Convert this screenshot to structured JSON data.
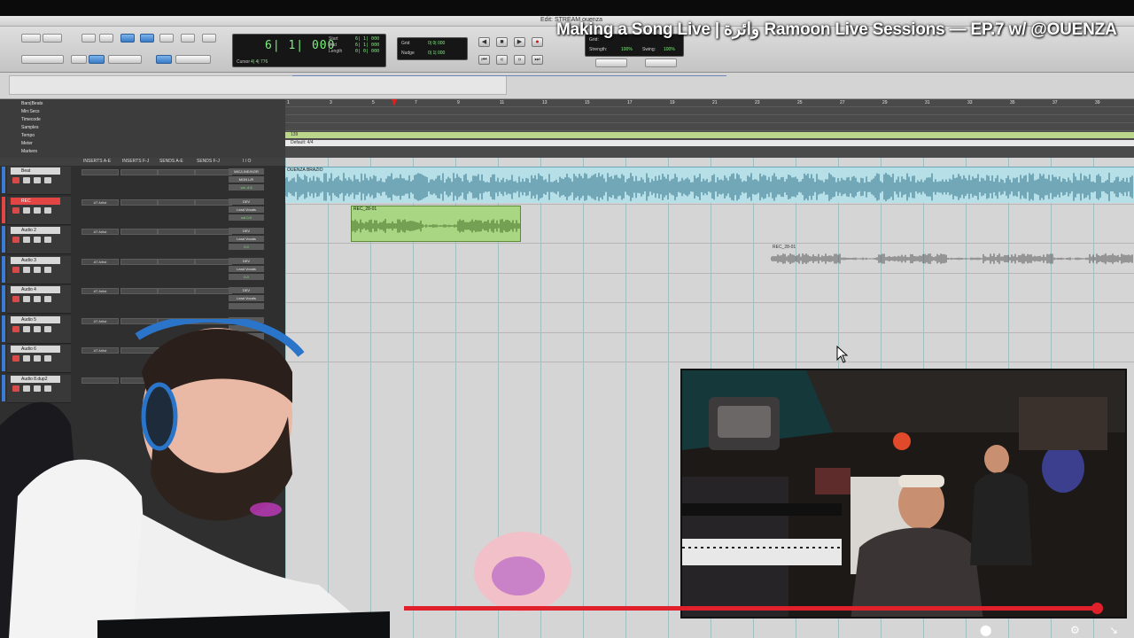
{
  "video": {
    "title": "Making a Song Live | وائرة Ramoon Live Sessions — EP.7 w/ @OUENZA",
    "progress": 0.94
  },
  "window": {
    "title": "Edit: STREAM ouenza"
  },
  "counter": {
    "main": "6| 1| 000",
    "start_label": "Start",
    "end_label": "End",
    "length_label": "Length",
    "start": "6| 1| 000",
    "end": "6| 1| 000",
    "length": "0| 0| 000",
    "cursor_label": "Cursor",
    "cursor": "4| 4| 776"
  },
  "nudge": {
    "grid_label": "Grid",
    "nudge_label": "Nudge",
    "grid_value": "0| 0| 000",
    "nudge_value": "0| 1| 000"
  },
  "quantize": {
    "grid_label": "Grid:",
    "strength_label": "Strength:",
    "strength": "100%",
    "swing_label": "Swing:",
    "swing": "100%"
  },
  "rulers": {
    "labels": [
      "Bars|Beats",
      "Min:Secs",
      "Timecode",
      "Samples",
      "Tempo",
      "Meter",
      "Markers"
    ],
    "bars": [
      "1",
      "3",
      "5",
      "7",
      "9",
      "11",
      "13",
      "15",
      "17",
      "19",
      "21",
      "23",
      "25",
      "27",
      "29",
      "31",
      "33",
      "35",
      "37",
      "39"
    ],
    "tempo": "139",
    "meter": "Default: 4/4"
  },
  "mix": {
    "columns": [
      "INSERTS A-E",
      "INSERTS F-J",
      "SENDS A-E",
      "SENDS F-J",
      "I / O"
    ],
    "tracks": [
      {
        "name": "Beat",
        "color": "#3a7bd5",
        "insert": "",
        "io1": "MIC/LINE/HZ/R",
        "io2": "MON L/R",
        "vol": "vol -4.6"
      },
      {
        "name": "REC",
        "color": "#e34444",
        "insert": "AT Artist",
        "io1": "DEV",
        "io2": "Lead Vocals",
        "vol": "vol 0.0",
        "rec": true
      },
      {
        "name": "Audio 2",
        "color": "#3a7bd5",
        "insert": "AT Artist",
        "io1": "DEV",
        "io2": "Lead Vocals",
        "vol": "0.0"
      },
      {
        "name": "Audio 3",
        "color": "#3a7bd5",
        "insert": "AT Artist",
        "io1": "DEV",
        "io2": "Lead Vocals",
        "vol": "0.0"
      },
      {
        "name": "Audio 4",
        "color": "#3a7bd5",
        "insert": "AT Artist",
        "io1": "DEV",
        "io2": "Lead Vocals",
        "vol": ""
      },
      {
        "name": "Audio 5",
        "color": "#3a7bd5",
        "insert": "AT Artist",
        "io1": "",
        "io2": "",
        "vol": ""
      },
      {
        "name": "Audio 6",
        "color": "#3a7bd5",
        "insert": "AT Artist",
        "io1": "",
        "io2": "",
        "vol": ""
      },
      {
        "name": "Audio 8.dup2",
        "color": "#3a7bd5",
        "insert": "",
        "io1": "",
        "io2": "",
        "vol": ""
      }
    ]
  },
  "clips": {
    "beat": "OUENZA BRAZIO",
    "rec1": "REC_28-01",
    "rec2": "REC_28-01"
  },
  "colors": {
    "accent": "#3a7bc8",
    "record": "#e0202a",
    "beat_clip": "#b6dfe8",
    "rec_clip": "#a9d682"
  },
  "icons": [
    "play-icon",
    "stop-icon",
    "record-icon",
    "rewind-icon",
    "forward-icon",
    "zoom-icon",
    "cursor-icon"
  ]
}
